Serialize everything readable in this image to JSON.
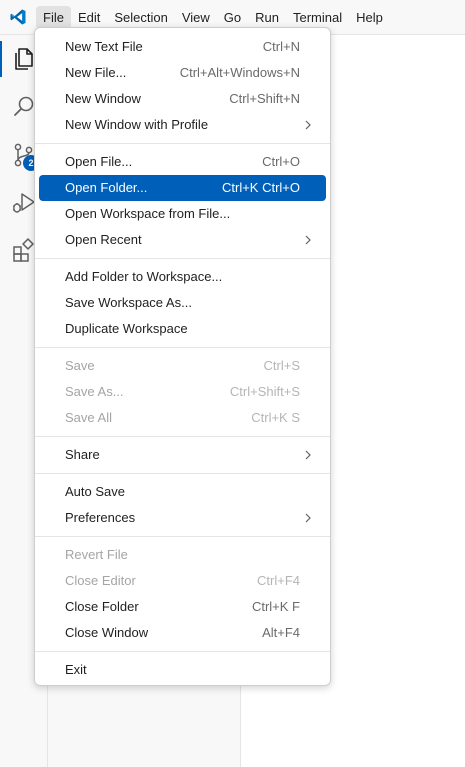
{
  "menubar": {
    "items": [
      {
        "label": "File"
      },
      {
        "label": "Edit"
      },
      {
        "label": "Selection"
      },
      {
        "label": "View"
      },
      {
        "label": "Go"
      },
      {
        "label": "Run"
      },
      {
        "label": "Terminal"
      },
      {
        "label": "Help"
      }
    ],
    "active": "File"
  },
  "activitybar": {
    "icons": [
      "explorer-icon",
      "search-icon",
      "source-control-icon",
      "run-debug-icon",
      "extensions-icon"
    ],
    "scm_badge": "2"
  },
  "file_menu": {
    "groups": [
      [
        {
          "label": "New Text File",
          "shortcut": "Ctrl+N"
        },
        {
          "label": "New File...",
          "shortcut": "Ctrl+Alt+Windows+N"
        },
        {
          "label": "New Window",
          "shortcut": "Ctrl+Shift+N"
        },
        {
          "label": "New Window with Profile",
          "submenu": true
        }
      ],
      [
        {
          "label": "Open File...",
          "shortcut": "Ctrl+O"
        },
        {
          "label": "Open Folder...",
          "shortcut": "Ctrl+K Ctrl+O",
          "selected": true
        },
        {
          "label": "Open Workspace from File..."
        },
        {
          "label": "Open Recent",
          "submenu": true
        }
      ],
      [
        {
          "label": "Add Folder to Workspace..."
        },
        {
          "label": "Save Workspace As..."
        },
        {
          "label": "Duplicate Workspace"
        }
      ],
      [
        {
          "label": "Save",
          "shortcut": "Ctrl+S",
          "disabled": true
        },
        {
          "label": "Save As...",
          "shortcut": "Ctrl+Shift+S",
          "disabled": true
        },
        {
          "label": "Save All",
          "shortcut": "Ctrl+K S",
          "disabled": true
        }
      ],
      [
        {
          "label": "Share",
          "submenu": true
        }
      ],
      [
        {
          "label": "Auto Save"
        },
        {
          "label": "Preferences",
          "submenu": true
        }
      ],
      [
        {
          "label": "Revert File",
          "disabled": true
        },
        {
          "label": "Close Editor",
          "shortcut": "Ctrl+F4",
          "disabled": true
        },
        {
          "label": "Close Folder",
          "shortcut": "Ctrl+K F"
        },
        {
          "label": "Close Window",
          "shortcut": "Alt+F4"
        }
      ],
      [
        {
          "label": "Exit"
        }
      ]
    ]
  },
  "colors": {
    "accent": "#005fb8",
    "menu_bg": "#ffffff",
    "disabled_text": "#a5a5a5"
  }
}
